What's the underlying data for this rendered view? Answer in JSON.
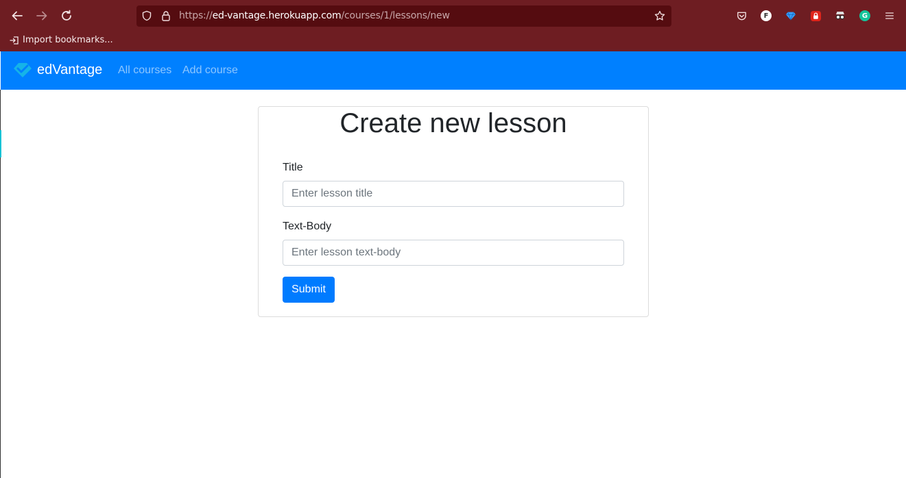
{
  "browser": {
    "url_prefix": "https://",
    "url_host": "ed-vantage.herokuapp.com",
    "url_path": "/courses/1/lessons/new",
    "bookmark_import_label": "Import bookmarks...",
    "extensions": {
      "f_badge": "F",
      "grammarly_badge": "G"
    },
    "colors": {
      "chrome_bg": "#6e1d22",
      "urlbar_bg": "#550c10"
    }
  },
  "app": {
    "brand": "edVantage",
    "nav": [
      {
        "label": "All courses"
      },
      {
        "label": "Add course"
      }
    ],
    "colors": {
      "navbar_bg": "#0080ff",
      "primary": "#007bff"
    }
  },
  "form": {
    "heading": "Create new lesson",
    "title_label": "Title",
    "title_placeholder": "Enter lesson title",
    "title_value": "",
    "body_label": "Text-Body",
    "body_placeholder": "Enter lesson text-body",
    "body_value": "",
    "submit_label": "Submit"
  }
}
